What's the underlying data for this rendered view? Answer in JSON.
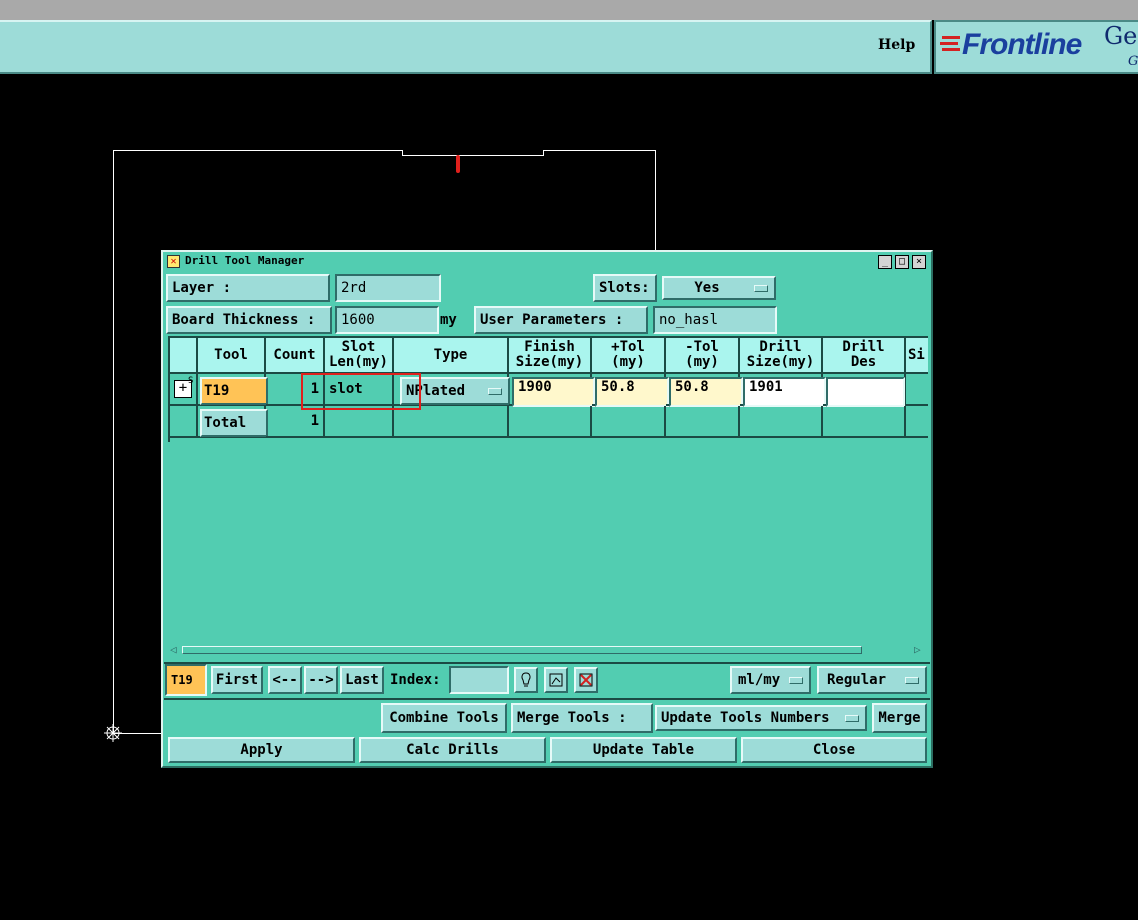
{
  "top_bar": {
    "help_label": "Help"
  },
  "logo": {
    "brand": "Frontline",
    "suffix_top": "Ge",
    "suffix_bottom": "G"
  },
  "dialog": {
    "title": "Drill Tool Manager",
    "controls": {
      "minimize": "_",
      "maximize": "□",
      "close": "×"
    },
    "layer_label": "Layer            :",
    "layer_value": "2rd",
    "slots_label": "Slots:",
    "slots_value": "Yes",
    "board_thickness_label": "Board Thickness :",
    "board_thickness_value": "1600",
    "board_thickness_unit": "my",
    "user_params_label": "User Parameters :",
    "user_params_value": "no_hasl",
    "table": {
      "headers": [
        {
          "l1": "",
          "l2": ""
        },
        {
          "l1": "Tool",
          "l2": ""
        },
        {
          "l1": "Count",
          "l2": ""
        },
        {
          "l1": "Slot",
          "l2": "Len(my)"
        },
        {
          "l1": "Type",
          "l2": ""
        },
        {
          "l1": "Finish",
          "l2": "Size(my)"
        },
        {
          "l1": "+Tol",
          "l2": "(my)"
        },
        {
          "l1": "-Tol",
          "l2": "(my)"
        },
        {
          "l1": "Drill",
          "l2": "Size(my)"
        },
        {
          "l1": "Drill",
          "l2": "Des"
        },
        {
          "l1": "Si",
          "l2": ""
        }
      ],
      "row": {
        "expander": "+",
        "expander_sup": "S",
        "tool": "T19",
        "count": "1",
        "slot_len": "slot",
        "type": "NPlated",
        "finish_size": "1900",
        "plus_tol": "50.8",
        "minus_tol": "50.8",
        "drill_size": "1901",
        "drill_des": ""
      },
      "total": {
        "label": "Total",
        "count": "1"
      }
    },
    "nav": {
      "current_tool": "T19",
      "first": "First",
      "prev": "<--",
      "next": "-->",
      "last": "Last",
      "index_label": "Index:",
      "index_value": "",
      "units": "ml/my",
      "mode": "Regular"
    },
    "actions": {
      "combine_tools": "Combine Tools",
      "merge_tools_label": "Merge Tools :",
      "update_tools_numbers": "Update Tools Numbers",
      "merge": "Merge",
      "apply": "Apply",
      "calc_drills": "Calc Drills",
      "update_table": "Update Table",
      "close": "Close"
    }
  }
}
